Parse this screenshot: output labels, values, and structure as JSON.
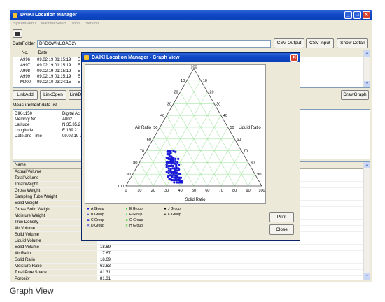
{
  "app": {
    "title": "DAIKI Location Manager",
    "menu": [
      "SystemMenu",
      "MachineSelect",
      "Tools",
      "Version"
    ],
    "data_folder_label": "DataFolder",
    "data_folder_value": "D:\\DOWNLOAD2\\",
    "buttons": {
      "csv_output": "CSV Output",
      "csv_input": "CSV Input",
      "show_detail": "Show Detail",
      "link_add": "LinkAdd",
      "link_open": "LinkOpen",
      "link_d": "LinkD",
      "draw_graph": "DrawGraph"
    },
    "records_table": {
      "headers": [
        "No.",
        "Date"
      ],
      "rows": [
        {
          "no": "A996",
          "date": "09.02.19 01:15:19",
          "extra": "E"
        },
        {
          "no": "A997",
          "date": "09.02.19 01:15:19",
          "extra": "E"
        },
        {
          "no": "A998",
          "date": "09.02.19 01:15:19",
          "extra": "E"
        },
        {
          "no": "A999",
          "date": "09.02.19 01:15:19",
          "extra": "E"
        },
        {
          "no": "M000",
          "date": "09.02.10 03:24:15",
          "extra": "E"
        }
      ]
    },
    "measurement": {
      "title": "Measurement data list",
      "rows": [
        {
          "label": "DIK-1150",
          "value": "Digital Ac"
        },
        {
          "label": "Memory No.",
          "value": "A002"
        },
        {
          "label": "Latitude",
          "value": "N 35.35.2"
        },
        {
          "label": "Longitude",
          "value": "E 139.21."
        },
        {
          "label": "Date and Time",
          "value": "09.02.19 0"
        }
      ]
    },
    "properties": {
      "header": "Name",
      "rows": [
        {
          "name": "Actual Volume",
          "value": ""
        },
        {
          "name": "Total Volume",
          "value": ""
        },
        {
          "name": "Total Weight",
          "value": ""
        },
        {
          "name": "Gross Weight",
          "value": ""
        },
        {
          "name": "Sampling Tube Weight",
          "value": ""
        },
        {
          "name": "Solid Weight",
          "value": ""
        },
        {
          "name": "Gross Solid Weight",
          "value": ""
        },
        {
          "name": "Moisture Weight",
          "value": ""
        },
        {
          "name": "True Density",
          "value": ""
        },
        {
          "name": "Air Volume",
          "value": ""
        },
        {
          "name": "Solid Volume",
          "value": ""
        },
        {
          "name": "Liquid Volume",
          "value": ""
        },
        {
          "name": "Solid Volume",
          "value": "18.69"
        },
        {
          "name": "Air Ratio",
          "value": "17.67"
        },
        {
          "name": "Solid Ratio",
          "value": "18.69"
        },
        {
          "name": "Moisture Ratio",
          "value": "63.63"
        },
        {
          "name": "Total Pore Space",
          "value": "81.31"
        },
        {
          "name": "Porosity",
          "value": "81.31"
        }
      ]
    }
  },
  "graph_dialog": {
    "title": "DAIKI Location Manager - Graph View",
    "print_label": "Print",
    "close_label": "Close",
    "legend": [
      {
        "symbol": "●",
        "label": "A Group",
        "color": "#1a1ad8"
      },
      {
        "symbol": "▲",
        "label": "B Group",
        "color": "#1a1ad8"
      },
      {
        "symbol": "■",
        "label": "C Group",
        "color": "#1a1ad8"
      },
      {
        "symbol": "✕",
        "label": "D Group",
        "color": "#1a1ad8"
      },
      {
        "symbol": "●",
        "label": "E Group",
        "color": "#2ad42a"
      },
      {
        "symbol": "▲",
        "label": "F Group",
        "color": "#2ad42a"
      },
      {
        "symbol": "■",
        "label": "G Group",
        "color": "#2ad42a"
      },
      {
        "symbol": "✕",
        "label": "H Group",
        "color": "#2ad42a"
      },
      {
        "symbol": "●",
        "label": "J Group",
        "color": "#000000"
      },
      {
        "symbol": "▲",
        "label": "K Group",
        "color": "#000000"
      }
    ]
  },
  "chart_data": {
    "type": "scatter",
    "subtype": "ternary",
    "axes": {
      "left": {
        "label": "Air Ratio",
        "ticks": [
          "10",
          "20",
          "30",
          "40",
          "50",
          "60",
          "70",
          "80",
          "90",
          "100"
        ]
      },
      "right": {
        "label": "Liquid Ratio",
        "ticks": [
          "10",
          "20",
          "30",
          "40",
          "50",
          "60",
          "70",
          "80",
          "90",
          "100"
        ]
      },
      "bottom": {
        "label": "Solid Ratio",
        "ticks": [
          "0",
          "10",
          "20",
          "30",
          "40",
          "50",
          "60",
          "70",
          "80",
          "90",
          "100"
        ]
      },
      "top_label": "100"
    },
    "grid": true,
    "grid_color": "#a8e6a8",
    "point_color": "#1a1ad8",
    "series": [
      {
        "name": "A Group",
        "note": "approximate cluster (solid%, liquid%, air%)",
        "points": [
          [
            18,
            52,
            30
          ],
          [
            20,
            50,
            30
          ],
          [
            22,
            49,
            29
          ],
          [
            19,
            55,
            26
          ],
          [
            21,
            56,
            23
          ],
          [
            23,
            53,
            24
          ],
          [
            25,
            52,
            23
          ],
          [
            24,
            56,
            20
          ],
          [
            26,
            55,
            19
          ],
          [
            27,
            50,
            23
          ],
          [
            28,
            52,
            20
          ],
          [
            22,
            58,
            20
          ],
          [
            20,
            60,
            20
          ],
          [
            18,
            58,
            24
          ],
          [
            17,
            56,
            27
          ],
          [
            16,
            54,
            30
          ],
          [
            25,
            58,
            17
          ],
          [
            27,
            58,
            15
          ],
          [
            29,
            55,
            16
          ],
          [
            30,
            52,
            18
          ],
          [
            26,
            60,
            14
          ],
          [
            24,
            61,
            15
          ],
          [
            22,
            62,
            16
          ],
          [
            28,
            60,
            12
          ],
          [
            30,
            58,
            12
          ],
          [
            31,
            56,
            13
          ],
          [
            32,
            54,
            14
          ],
          [
            29,
            62,
            9
          ],
          [
            31,
            60,
            9
          ],
          [
            33,
            58,
            9
          ],
          [
            34,
            56,
            10
          ],
          [
            35,
            55,
            10
          ],
          [
            28,
            63,
            9
          ],
          [
            26,
            63,
            11
          ],
          [
            24,
            64,
            12
          ],
          [
            30,
            62,
            8
          ],
          [
            32,
            61,
            7
          ],
          [
            34,
            60,
            6
          ],
          [
            33,
            62,
            5
          ],
          [
            36,
            58,
            6
          ],
          [
            35,
            60,
            5
          ],
          [
            37,
            56,
            7
          ],
          [
            31,
            64,
            5
          ],
          [
            29,
            65,
            6
          ],
          [
            27,
            65,
            8
          ],
          [
            36,
            61,
            3
          ],
          [
            38,
            58,
            4
          ],
          [
            39,
            57,
            4
          ],
          [
            34,
            63,
            3
          ],
          [
            37,
            60,
            3
          ],
          [
            21,
            54,
            25
          ],
          [
            23,
            55,
            22
          ],
          [
            19,
            53,
            28
          ],
          [
            17,
            53,
            30
          ],
          [
            20,
            57,
            23
          ],
          [
            22,
            54,
            24
          ],
          [
            24,
            54,
            22
          ],
          [
            26,
            53,
            21
          ],
          [
            28,
            54,
            18
          ],
          [
            30,
            55,
            15
          ],
          [
            32,
            57,
            11
          ],
          [
            34,
            58,
            8
          ],
          [
            36,
            57,
            7
          ],
          [
            33,
            59,
            8
          ],
          [
            27,
            61,
            12
          ],
          [
            25,
            62,
            13
          ],
          [
            23,
            60,
            17
          ],
          [
            21,
            59,
            20
          ],
          [
            19,
            57,
            24
          ],
          [
            18,
            55,
            27
          ],
          [
            29,
            59,
            12
          ],
          [
            31,
            58,
            11
          ],
          [
            35,
            58,
            7
          ],
          [
            38,
            59,
            3
          ],
          [
            40,
            57,
            3
          ],
          [
            37,
            58,
            5
          ],
          [
            33,
            60,
            7
          ],
          [
            26,
            57,
            17
          ],
          [
            24,
            59,
            17
          ],
          [
            28,
            57,
            15
          ],
          [
            30,
            60,
            10
          ],
          [
            32,
            59,
            9
          ],
          [
            22,
            56,
            22
          ],
          [
            20,
            55,
            25
          ],
          [
            27,
            54,
            19
          ],
          [
            25,
            55,
            20
          ],
          [
            29,
            57,
            14
          ],
          [
            31,
            54,
            15
          ],
          [
            23,
            57,
            20
          ],
          [
            21,
            61,
            18
          ],
          [
            39,
            58,
            3
          ],
          [
            36,
            59,
            5
          ],
          [
            34,
            61,
            5
          ],
          [
            32,
            63,
            5
          ],
          [
            30,
            64,
            6
          ],
          [
            28,
            61,
            11
          ],
          [
            26,
            61,
            13
          ],
          [
            24,
            57,
            19
          ],
          [
            18,
            54,
            28
          ],
          [
            16,
            55,
            29
          ]
        ]
      }
    ]
  },
  "caption": "Graph View"
}
